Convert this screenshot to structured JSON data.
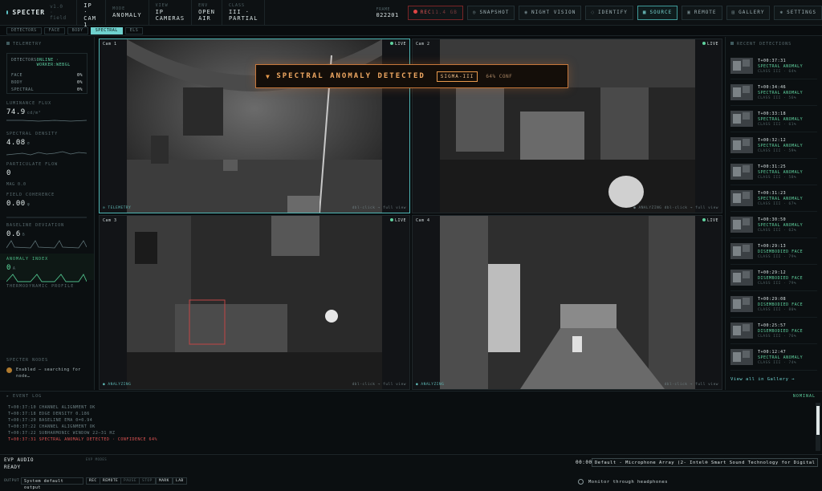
{
  "header": {
    "brand": "SPECTER",
    "version": "v1.0 · field",
    "groups": [
      {
        "key": "SRC",
        "value": "IP · CAM 1"
      },
      {
        "key": "MODE",
        "value": "ANOMALY"
      },
      {
        "key": "VIEW",
        "value": "IP CAMERAS"
      },
      {
        "key": "ENV",
        "value": "OPEN AIR"
      },
      {
        "key": "CLASS",
        "value": "III · PARTIAL"
      }
    ],
    "frame_key": "FRAME",
    "frame_value": "022201",
    "rec_label": "REC",
    "rec_size": "11.4 GB",
    "buttons": {
      "snapshot": "SNAPSHOT",
      "night_vision": "NIGHT VISION",
      "identify": "IDENTIFY",
      "source": "SOURCE",
      "remote": "REMOTE",
      "gallery": "GALLERY",
      "settings": "SETTINGS"
    }
  },
  "tabs": [
    "DETECTORS",
    "FACE",
    "BODY",
    "SPECTRAL",
    "ELS"
  ],
  "active_tab": "SPECTRAL",
  "telemetry": {
    "title": "TELEMETRY",
    "detectors_label": "DETECTORS",
    "detectors_status": "ONLINE · WORKER:WEBGL",
    "rows": [
      {
        "label": "FACE",
        "value": "0%"
      },
      {
        "label": "BODY",
        "value": "0%"
      },
      {
        "label": "SPECTRAL",
        "value": "0%"
      }
    ],
    "luminance_label": "LUMINANCE FLUX",
    "luminance_value": "74.9",
    "luminance_unit": "cd/m²",
    "spectral_label": "SPECTRAL DENSITY",
    "spectral_value": "4.08",
    "spectral_unit": "σ",
    "particulate_label": "PARTICULATE FLOW",
    "particulate_value": "0",
    "particulate_sub": "MAG 0.0",
    "coherence_label": "FIELD COHERENCE",
    "coherence_value": "0.00",
    "coherence_unit": "φ",
    "deviation_label": "BASELINE DEVIATION",
    "deviation_value": "0.6",
    "deviation_unit": "δ",
    "anomaly_label": "ANOMALY INDEX",
    "anomaly_value": "0",
    "anomaly_unit": "A",
    "thermo_label": "THERMODYNAMIC PROFILE",
    "spirit_label": "SPECTER NODES",
    "spirit_text": "Enabled – searching for node…"
  },
  "cameras": [
    {
      "label": "Cam 1",
      "live": "LIVE",
      "bl": "⊙ TELEMETRY",
      "br": "dbl-click → full view"
    },
    {
      "label": "Cam 2",
      "live": "LIVE",
      "bl": "",
      "br": "● ANALYZING   dbl-click → full view"
    },
    {
      "label": "Cam 3",
      "live": "LIVE",
      "bl": "● ANALYZING",
      "br": "dbl-click → full view"
    },
    {
      "label": "Cam 4",
      "live": "LIVE",
      "bl": "● ANALYZING",
      "br": "dbl-click → full view"
    }
  ],
  "alert": {
    "title": "SPECTRAL ANOMALY DETECTED",
    "badge": "SIGMA-III",
    "confidence": "64% CONF"
  },
  "detections": {
    "title": "RECENT DETECTIONS",
    "items": [
      {
        "time": "T+00:37:31",
        "name": "SPECTRAL ANOMALY",
        "cls": "CLASS III · 64%"
      },
      {
        "time": "T+00:34:46",
        "name": "SPECTRAL ANOMALY",
        "cls": "CLASS III · 56%"
      },
      {
        "time": "T+00:33:18",
        "name": "SPECTRAL ANOMALY",
        "cls": "CLASS III · 61%"
      },
      {
        "time": "T+00:32:12",
        "name": "SPECTRAL ANOMALY",
        "cls": "CLASS III · 59%"
      },
      {
        "time": "T+00:31:25",
        "name": "SPECTRAL ANOMALY",
        "cls": "CLASS III · 58%"
      },
      {
        "time": "T+00:31:23",
        "name": "SPECTRAL ANOMALY",
        "cls": "CLASS III · 67%"
      },
      {
        "time": "T+00:30:50",
        "name": "SPECTRAL ANOMALY",
        "cls": "CLASS III · 62%"
      },
      {
        "time": "T+00:29:13",
        "name": "DISEMBODIED FACE",
        "cls": "CLASS III · 79%"
      },
      {
        "time": "T+00:29:12",
        "name": "DISEMBODIED FACE",
        "cls": "CLASS III · 79%"
      },
      {
        "time": "T+00:29:08",
        "name": "DISEMBODIED FACE",
        "cls": "CLASS III · 80%"
      },
      {
        "time": "T+00:25:57",
        "name": "DISEMBODIED FACE",
        "cls": "CLASS III · 76%"
      },
      {
        "time": "T+00:12:47",
        "name": "SPECTRAL ANOMALY",
        "cls": "CLASS III · 74%"
      }
    ],
    "view_all": "View all in Gallery →"
  },
  "event_log": {
    "title": "EVENT LOG",
    "status": "NOMINAL",
    "lines": [
      "T+00:37:10  CHANNEL ALIGNMENT OK",
      "T+00:37:18  EDGE DENSITY 0.186",
      "T+00:37:20  BASELINE EMA 0=0.94",
      "T+00:37:22  CHANNEL ALIGNMENT OK",
      "T+00:37:22  SUBHARMONIC WINDOW 22–31 HZ",
      "T+00:37:31  SPECTRAL ANOMALY DETECTED · CONFIDENCE 64%"
    ]
  },
  "evp": {
    "title": "EVP AUDIO",
    "status": "READY",
    "mode": "EVP MODES",
    "output_label": "OUTPUT",
    "output_device": "System default output",
    "controls": [
      "REC",
      "REMOTE",
      "PAUSE",
      "STOP",
      "MARK",
      "LAB"
    ],
    "timer": "00:00",
    "mic_device": "Default - Microphone Array (2- Intel® Smart Sound Technology for Digital Microphones)",
    "monitor_label": "Monitor through headphones"
  },
  "colors": {
    "accent": "#6fd2cf",
    "alert": "#e99a4c",
    "rec": "#e05454",
    "ok": "#5fd19e"
  }
}
